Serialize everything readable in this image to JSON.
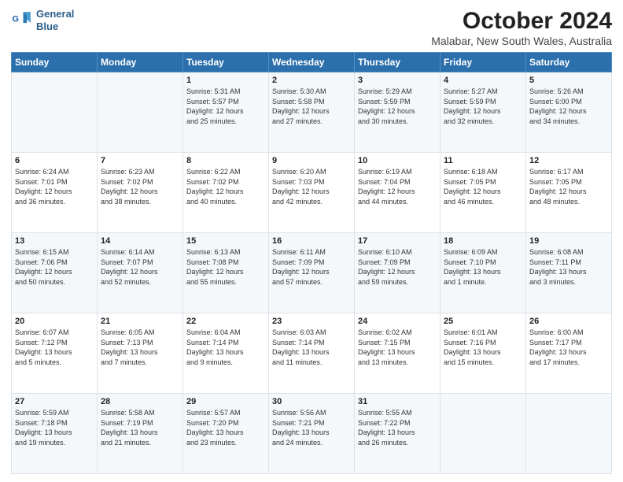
{
  "logo": {
    "line1": "General",
    "line2": "Blue"
  },
  "title": "October 2024",
  "subtitle": "Malabar, New South Wales, Australia",
  "headers": [
    "Sunday",
    "Monday",
    "Tuesday",
    "Wednesday",
    "Thursday",
    "Friday",
    "Saturday"
  ],
  "weeks": [
    [
      {
        "day": "",
        "info": ""
      },
      {
        "day": "",
        "info": ""
      },
      {
        "day": "1",
        "info": "Sunrise: 5:31 AM\nSunset: 5:57 PM\nDaylight: 12 hours\nand 25 minutes."
      },
      {
        "day": "2",
        "info": "Sunrise: 5:30 AM\nSunset: 5:58 PM\nDaylight: 12 hours\nand 27 minutes."
      },
      {
        "day": "3",
        "info": "Sunrise: 5:29 AM\nSunset: 5:59 PM\nDaylight: 12 hours\nand 30 minutes."
      },
      {
        "day": "4",
        "info": "Sunrise: 5:27 AM\nSunset: 5:59 PM\nDaylight: 12 hours\nand 32 minutes."
      },
      {
        "day": "5",
        "info": "Sunrise: 5:26 AM\nSunset: 6:00 PM\nDaylight: 12 hours\nand 34 minutes."
      }
    ],
    [
      {
        "day": "6",
        "info": "Sunrise: 6:24 AM\nSunset: 7:01 PM\nDaylight: 12 hours\nand 36 minutes."
      },
      {
        "day": "7",
        "info": "Sunrise: 6:23 AM\nSunset: 7:02 PM\nDaylight: 12 hours\nand 38 minutes."
      },
      {
        "day": "8",
        "info": "Sunrise: 6:22 AM\nSunset: 7:02 PM\nDaylight: 12 hours\nand 40 minutes."
      },
      {
        "day": "9",
        "info": "Sunrise: 6:20 AM\nSunset: 7:03 PM\nDaylight: 12 hours\nand 42 minutes."
      },
      {
        "day": "10",
        "info": "Sunrise: 6:19 AM\nSunset: 7:04 PM\nDaylight: 12 hours\nand 44 minutes."
      },
      {
        "day": "11",
        "info": "Sunrise: 6:18 AM\nSunset: 7:05 PM\nDaylight: 12 hours\nand 46 minutes."
      },
      {
        "day": "12",
        "info": "Sunrise: 6:17 AM\nSunset: 7:05 PM\nDaylight: 12 hours\nand 48 minutes."
      }
    ],
    [
      {
        "day": "13",
        "info": "Sunrise: 6:15 AM\nSunset: 7:06 PM\nDaylight: 12 hours\nand 50 minutes."
      },
      {
        "day": "14",
        "info": "Sunrise: 6:14 AM\nSunset: 7:07 PM\nDaylight: 12 hours\nand 52 minutes."
      },
      {
        "day": "15",
        "info": "Sunrise: 6:13 AM\nSunset: 7:08 PM\nDaylight: 12 hours\nand 55 minutes."
      },
      {
        "day": "16",
        "info": "Sunrise: 6:11 AM\nSunset: 7:09 PM\nDaylight: 12 hours\nand 57 minutes."
      },
      {
        "day": "17",
        "info": "Sunrise: 6:10 AM\nSunset: 7:09 PM\nDaylight: 12 hours\nand 59 minutes."
      },
      {
        "day": "18",
        "info": "Sunrise: 6:09 AM\nSunset: 7:10 PM\nDaylight: 13 hours\nand 1 minute."
      },
      {
        "day": "19",
        "info": "Sunrise: 6:08 AM\nSunset: 7:11 PM\nDaylight: 13 hours\nand 3 minutes."
      }
    ],
    [
      {
        "day": "20",
        "info": "Sunrise: 6:07 AM\nSunset: 7:12 PM\nDaylight: 13 hours\nand 5 minutes."
      },
      {
        "day": "21",
        "info": "Sunrise: 6:05 AM\nSunset: 7:13 PM\nDaylight: 13 hours\nand 7 minutes."
      },
      {
        "day": "22",
        "info": "Sunrise: 6:04 AM\nSunset: 7:14 PM\nDaylight: 13 hours\nand 9 minutes."
      },
      {
        "day": "23",
        "info": "Sunrise: 6:03 AM\nSunset: 7:14 PM\nDaylight: 13 hours\nand 11 minutes."
      },
      {
        "day": "24",
        "info": "Sunrise: 6:02 AM\nSunset: 7:15 PM\nDaylight: 13 hours\nand 13 minutes."
      },
      {
        "day": "25",
        "info": "Sunrise: 6:01 AM\nSunset: 7:16 PM\nDaylight: 13 hours\nand 15 minutes."
      },
      {
        "day": "26",
        "info": "Sunrise: 6:00 AM\nSunset: 7:17 PM\nDaylight: 13 hours\nand 17 minutes."
      }
    ],
    [
      {
        "day": "27",
        "info": "Sunrise: 5:59 AM\nSunset: 7:18 PM\nDaylight: 13 hours\nand 19 minutes."
      },
      {
        "day": "28",
        "info": "Sunrise: 5:58 AM\nSunset: 7:19 PM\nDaylight: 13 hours\nand 21 minutes."
      },
      {
        "day": "29",
        "info": "Sunrise: 5:57 AM\nSunset: 7:20 PM\nDaylight: 13 hours\nand 23 minutes."
      },
      {
        "day": "30",
        "info": "Sunrise: 5:56 AM\nSunset: 7:21 PM\nDaylight: 13 hours\nand 24 minutes."
      },
      {
        "day": "31",
        "info": "Sunrise: 5:55 AM\nSunset: 7:22 PM\nDaylight: 13 hours\nand 26 minutes."
      },
      {
        "day": "",
        "info": ""
      },
      {
        "day": "",
        "info": ""
      }
    ]
  ]
}
